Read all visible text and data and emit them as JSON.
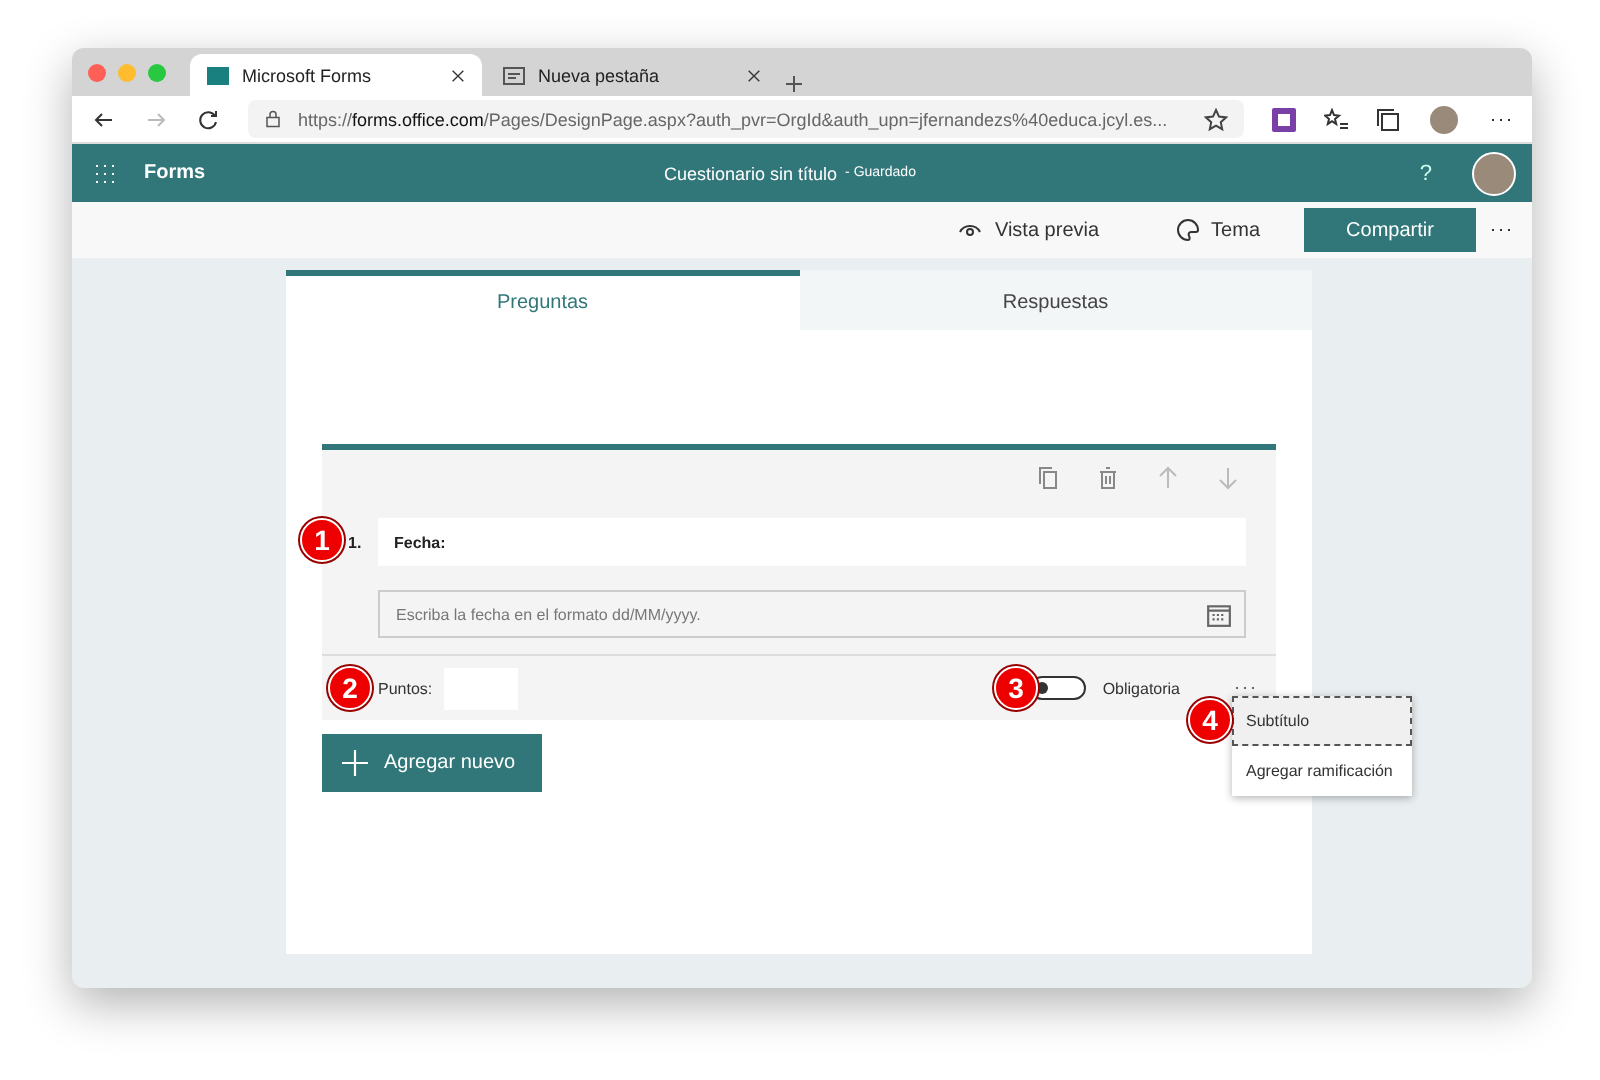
{
  "browser": {
    "tabs": [
      {
        "label": "Microsoft Forms",
        "selected": true
      },
      {
        "label": "Nueva pestaña",
        "selected": false
      }
    ],
    "url": "https://**forms.office.com**/Pages/DesignPage.aspx?auth_pvr=OrgId&auth_upn=jfernandezs%40educa.jcyl.es..."
  },
  "app": {
    "name": "Forms",
    "title": "Cuestionario sin título",
    "status": "- Guardado",
    "help": "?"
  },
  "commands": [
    {
      "label": "Vista previa",
      "kind": "eye"
    },
    {
      "label": "Tema",
      "kind": "palette"
    },
    {
      "label": "Compartir",
      "kind": "primary"
    }
  ],
  "form_tabs": [
    {
      "label": "Preguntas",
      "selected": true
    },
    {
      "label": "Respuestas",
      "selected": false
    }
  ],
  "question": {
    "number": "1.",
    "title": "Fecha:",
    "placeholder": "Escriba la fecha en el formato dd/MM/yyyy.",
    "points_label": "Puntos:",
    "required_label": "Obligatoria",
    "required": false
  },
  "add_button": "Agregar nuevo",
  "menu": [
    {
      "label": "Subtítulo",
      "selected": true
    },
    {
      "label": "Agregar ramificación",
      "selected": false
    }
  ],
  "callouts": [
    "1",
    "2",
    "3",
    "4"
  ]
}
